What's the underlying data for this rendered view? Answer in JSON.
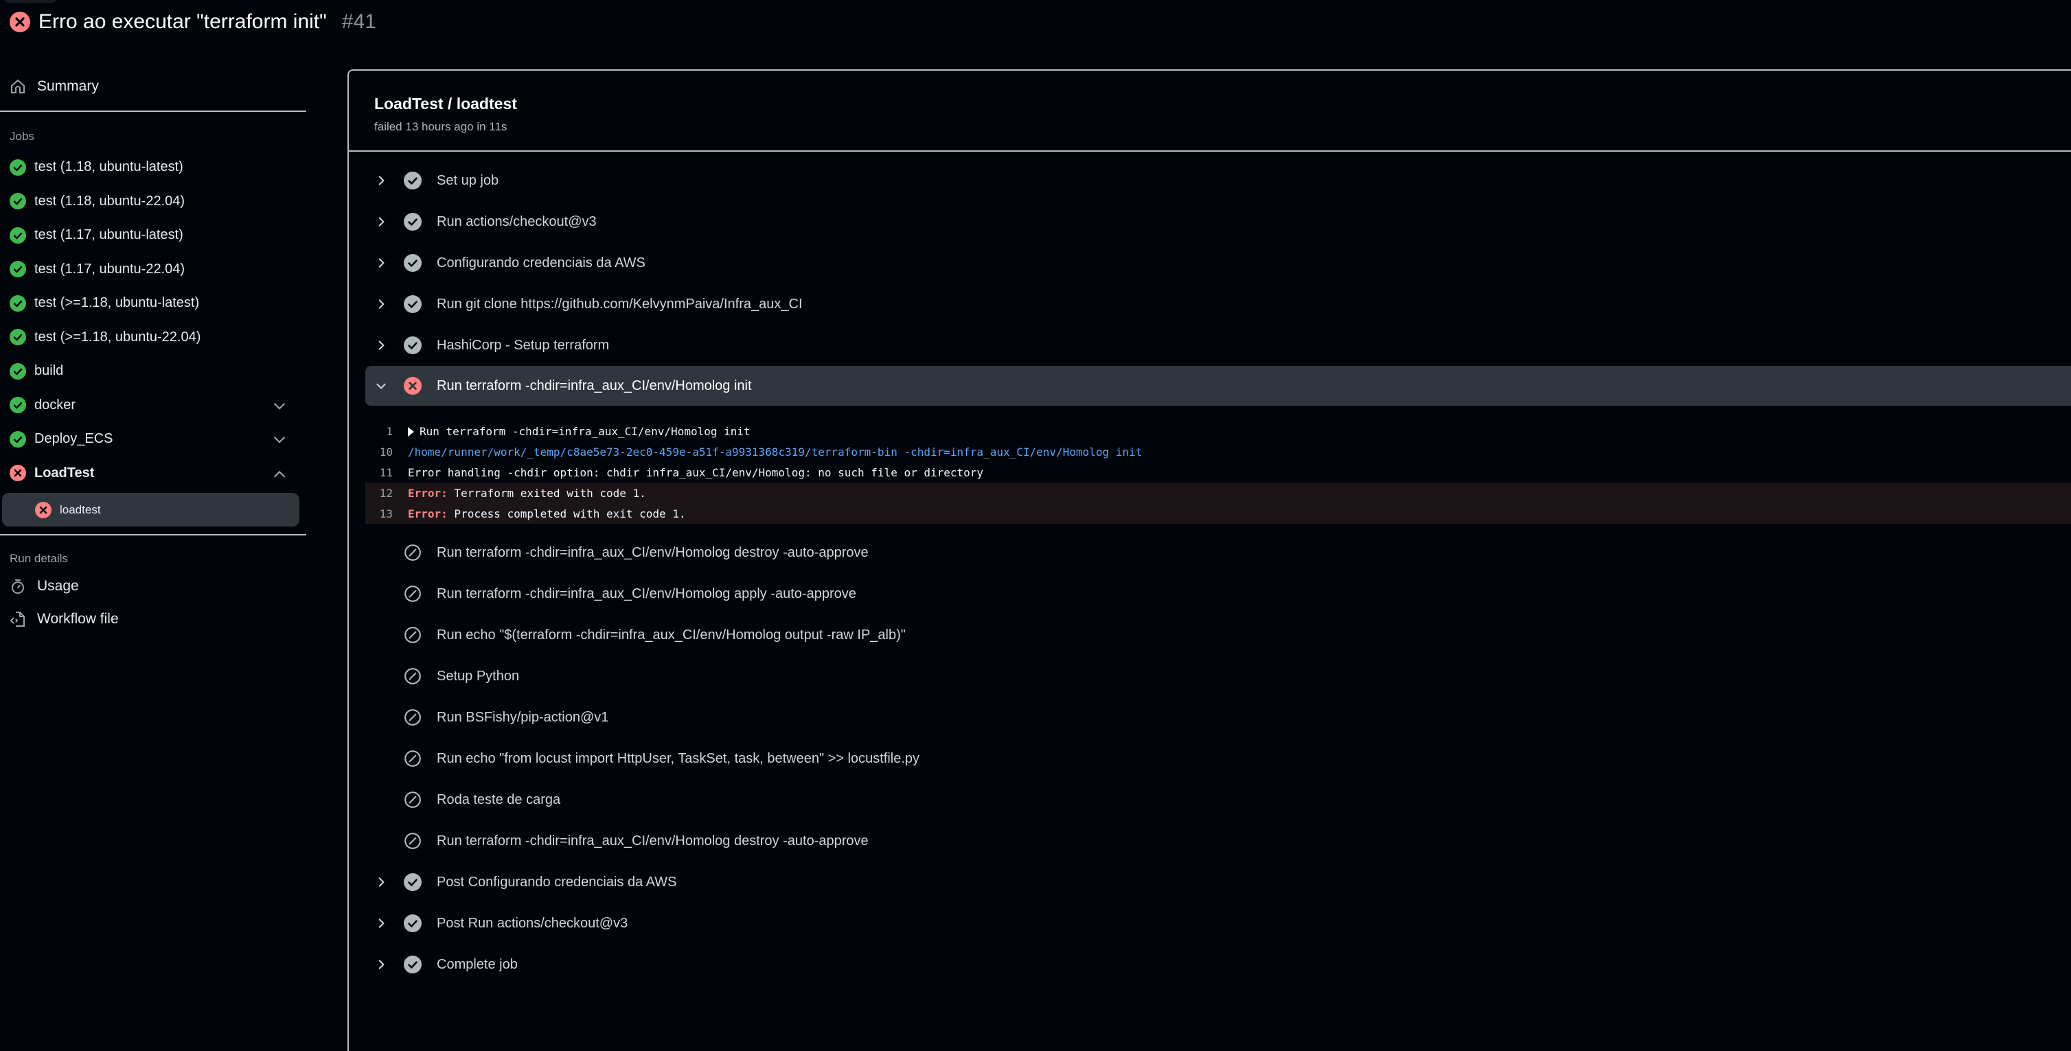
{
  "header": {
    "title": "Erro ao executar \"terraform init\"",
    "run_number": "#41",
    "status_icon": "x-circle-fill-icon"
  },
  "colors": {
    "success": "#3fb950",
    "failure": "#ff8182",
    "neutral": "#b1b8c0",
    "link_blue": "#58a6ff",
    "background": "#010409",
    "selected_bg": "#30363d"
  },
  "sidebar": {
    "summary_label": "Summary",
    "jobs_heading": "Jobs",
    "jobs": [
      {
        "label": "test (1.18, ubuntu-latest)",
        "status": "success"
      },
      {
        "label": "test (1.18, ubuntu-22.04)",
        "status": "success"
      },
      {
        "label": "test (1.17, ubuntu-latest)",
        "status": "success"
      },
      {
        "label": "test (1.17, ubuntu-22.04)",
        "status": "success"
      },
      {
        "label": "test (>=1.18, ubuntu-latest)",
        "status": "success"
      },
      {
        "label": "test (>=1.18, ubuntu-22.04)",
        "status": "success"
      },
      {
        "label": "build",
        "status": "success"
      },
      {
        "label": "docker",
        "status": "success",
        "expandable": "collapsed"
      },
      {
        "label": "Deploy_ECS",
        "status": "success",
        "expandable": "collapsed"
      },
      {
        "label": "LoadTest",
        "status": "failure",
        "expandable": "expanded"
      }
    ],
    "selected_subjob": {
      "label": "loadtest",
      "status": "failure"
    },
    "run_details_heading": "Run details",
    "usage_label": "Usage",
    "workflow_file_label": "Workflow file"
  },
  "main": {
    "job_title": "LoadTest / loadtest",
    "job_meta": "failed 13 hours ago in 11s",
    "steps_before": [
      {
        "label": "Set up job",
        "status": "success"
      },
      {
        "label": "Run actions/checkout@v3",
        "status": "success"
      },
      {
        "label": "Configurando credenciais da AWS",
        "status": "success"
      },
      {
        "label": "Run git clone https://github.com/KelvynmPaiva/Infra_aux_CI",
        "status": "success"
      },
      {
        "label": "HashiCorp - Setup terraform",
        "status": "success"
      }
    ],
    "expanded_step": {
      "label": "Run terraform -chdir=infra_aux_CI/env/Homolog init",
      "status": "failure",
      "log": [
        {
          "num": "1",
          "text": "Run terraform -chdir=infra_aux_CI/env/Homolog init",
          "kind": "group"
        },
        {
          "num": "10",
          "text": "/home/runner/work/_temp/c8ae5e73-2ec0-459e-a51f-a9931368c319/terraform-bin -chdir=infra_aux_CI/env/Homolog init",
          "kind": "command"
        },
        {
          "num": "11",
          "text": "Error handling -chdir option: chdir infra_aux_CI/env/Homolog: no such file or directory",
          "kind": "plain"
        },
        {
          "num": "12",
          "prefix": "Error:",
          "text": " Terraform exited with code 1.",
          "kind": "error"
        },
        {
          "num": "13",
          "prefix": "Error:",
          "text": " Process completed with exit code 1.",
          "kind": "error"
        }
      ]
    },
    "skipped_steps": [
      {
        "label": "Run terraform -chdir=infra_aux_CI/env/Homolog destroy -auto-approve",
        "status": "skipped"
      },
      {
        "label": "Run terraform -chdir=infra_aux_CI/env/Homolog apply -auto-approve",
        "status": "skipped"
      },
      {
        "label": "Run echo \"$(terraform -chdir=infra_aux_CI/env/Homolog output -raw IP_alb)\"",
        "status": "skipped"
      },
      {
        "label": "Setup Python",
        "status": "skipped"
      },
      {
        "label": "Run BSFishy/pip-action@v1",
        "status": "skipped"
      },
      {
        "label": "Run echo \"from locust import HttpUser, TaskSet, task, between\" >> locustfile.py",
        "status": "skipped"
      },
      {
        "label": "Roda teste de carga",
        "status": "skipped"
      },
      {
        "label": "Run terraform -chdir=infra_aux_CI/env/Homolog destroy -auto-approve",
        "status": "skipped"
      }
    ],
    "steps_after": [
      {
        "label": "Post Configurando credenciais da AWS",
        "status": "success"
      },
      {
        "label": "Post Run actions/checkout@v3",
        "status": "success"
      },
      {
        "label": "Complete job",
        "status": "success"
      }
    ]
  }
}
